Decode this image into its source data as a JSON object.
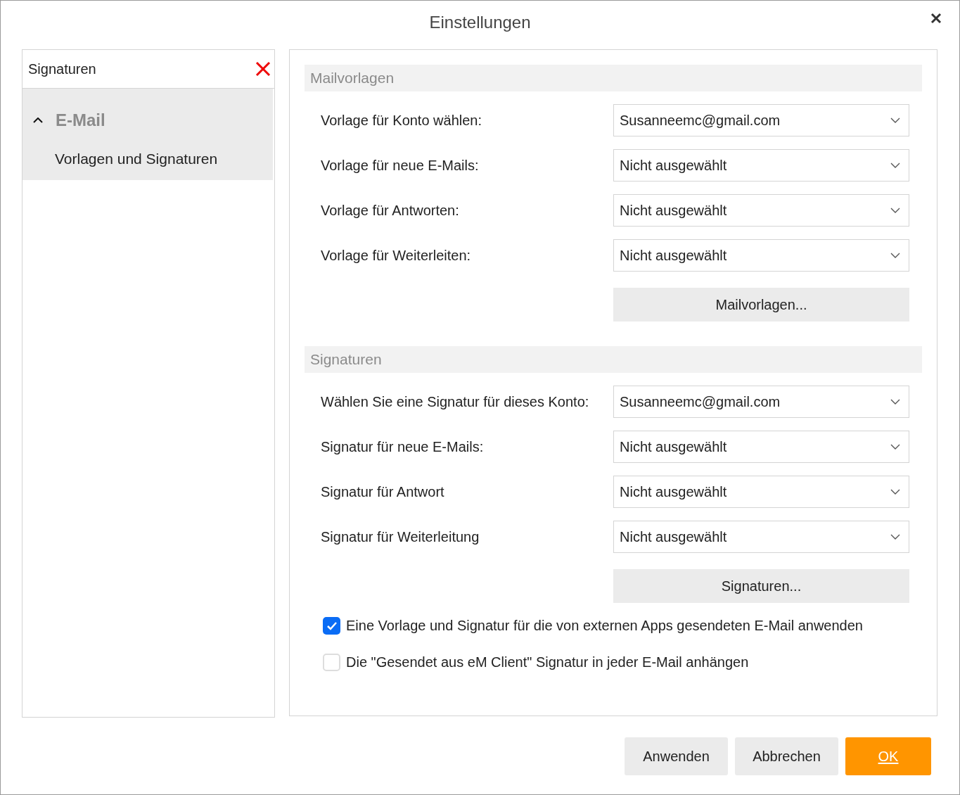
{
  "window": {
    "title": "Einstellungen"
  },
  "sidebar": {
    "search": {
      "value": "Signaturen"
    },
    "groups": [
      {
        "label": "E-Mail",
        "expanded": true,
        "children": [
          {
            "label": "Vorlagen und Signaturen",
            "selected": true
          }
        ]
      }
    ]
  },
  "sections": [
    {
      "title": "Mailvorlagen",
      "rows": [
        {
          "label": "Vorlage für Konto wählen:",
          "value": "Susanneemc@gmail.com"
        },
        {
          "label": "Vorlage für neue E-Mails:",
          "value": "Nicht ausgewählt"
        },
        {
          "label": "Vorlage für Antworten:",
          "value": "Nicht ausgewählt"
        },
        {
          "label": "Vorlage für Weiterleiten:",
          "value": "Nicht ausgewählt"
        }
      ],
      "button": "Mailvorlagen..."
    },
    {
      "title": "Signaturen",
      "rows": [
        {
          "label": "Wählen Sie eine Signatur für dieses Konto:",
          "value": "Susanneemc@gmail.com"
        },
        {
          "label": "Signatur für neue E-Mails:",
          "value": "Nicht ausgewählt"
        },
        {
          "label": "Signatur für Antwort",
          "value": "Nicht ausgewählt"
        },
        {
          "label": "Signatur für Weiterleitung",
          "value": "Nicht ausgewählt"
        }
      ],
      "button": "Signaturen..."
    }
  ],
  "checkboxes": [
    {
      "label": "Eine Vorlage und Signatur für die von externen Apps gesendeten E-Mail anwenden",
      "checked": true
    },
    {
      "label": "Die \"Gesendet aus eM Client\" Signatur in jeder E-Mail anhängen",
      "checked": false
    }
  ],
  "buttons": [
    {
      "label": "Anwenden",
      "kind": "secondary"
    },
    {
      "label": "Abbrechen",
      "kind": "secondary"
    },
    {
      "label": "OK",
      "kind": "primary"
    }
  ]
}
